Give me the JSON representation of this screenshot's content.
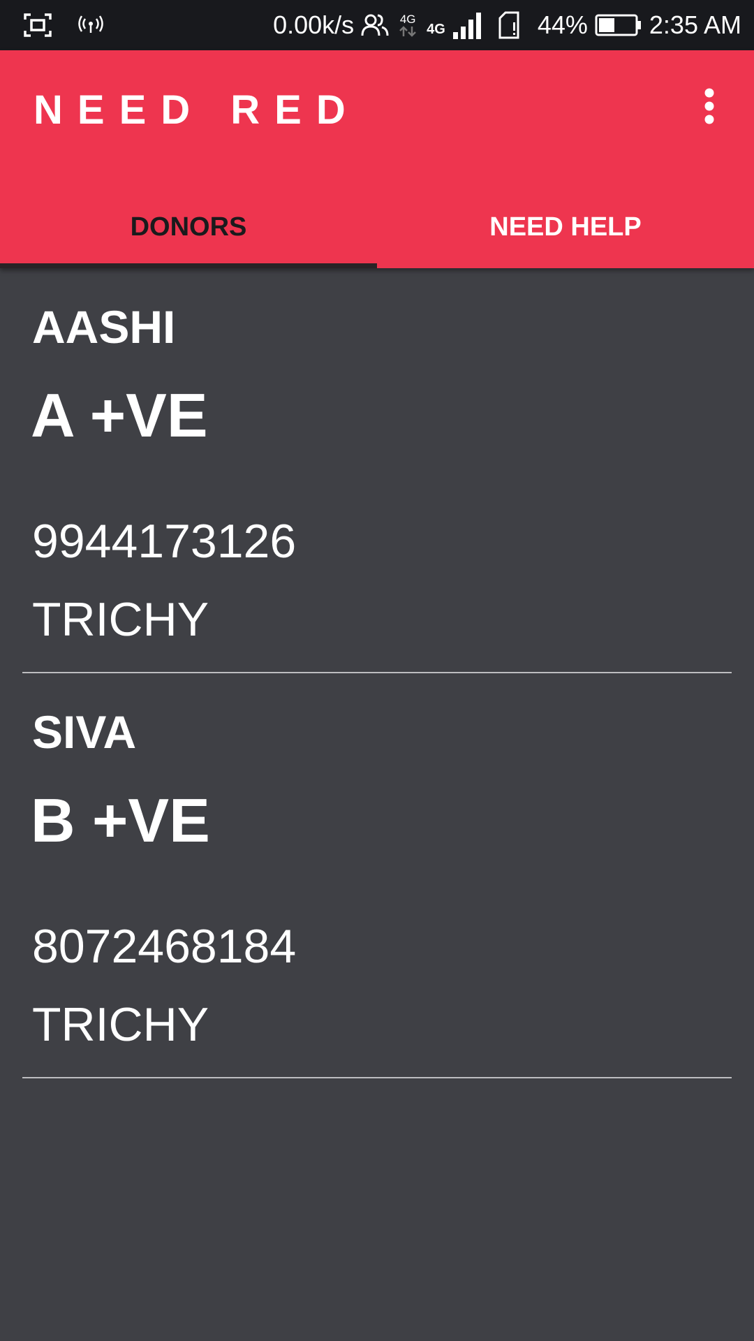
{
  "status_bar": {
    "network_speed": "0.00k/s",
    "battery_percent": "44%",
    "battery_level": 0.44,
    "time": "2:35 AM",
    "network_label_1": "4G",
    "network_label_2": "4G",
    "icons": [
      "screenshot-icon",
      "hotspot-icon",
      "contacts-icon",
      "data-4g-icon",
      "signal-icon",
      "sim-icon",
      "battery-icon"
    ]
  },
  "app_bar": {
    "title": "NEED RED",
    "menu_icon": "more-vert-icon"
  },
  "tabs": [
    {
      "label": "DONORS",
      "selected": true
    },
    {
      "label": "NEED HELP",
      "selected": false
    }
  ],
  "donors": [
    {
      "name": "AASHI",
      "blood_group": "A +VE",
      "phone": "9944173126",
      "city": "TRICHY"
    },
    {
      "name": "SIVA",
      "blood_group": "B +VE",
      "phone": "8072468184",
      "city": "TRICHY"
    }
  ],
  "colors": {
    "app_bar": "#ee354f",
    "background": "#3f4045",
    "status_bar": "#18191d",
    "tab_indicator": "#2a2326"
  }
}
